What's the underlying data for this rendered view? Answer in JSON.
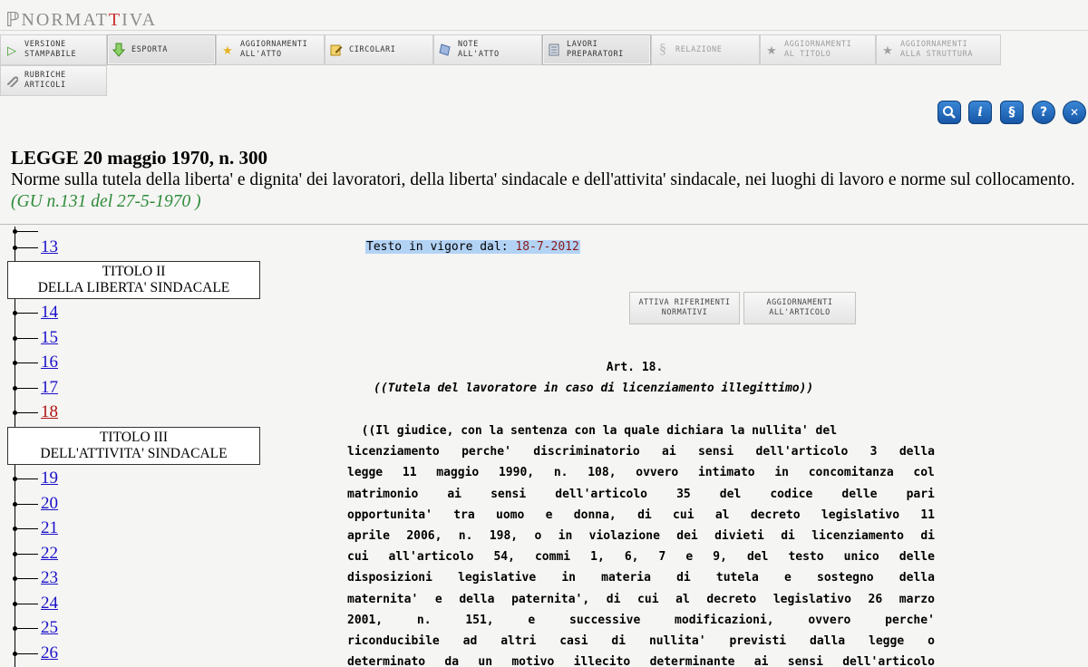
{
  "app": {
    "logo_mark": "ℙ",
    "logo_name_a": "NORMAT",
    "logo_name_b": "T",
    "logo_name_c": "IVA"
  },
  "toolbar": [
    {
      "id": "versione",
      "label": "VERSIONE\nSTAMPABILE",
      "icon": "play-icon",
      "color": "#3a9a2a"
    },
    {
      "id": "esporta",
      "label": "ESPORTA",
      "icon": "download-arrow-icon",
      "color": "#5aa532"
    },
    {
      "id": "agg-atto",
      "label": "AGGIORNAMENTI\nALL'ATTO",
      "icon": "star-icon",
      "color": "#e6b320"
    },
    {
      "id": "circolari",
      "label": "CIRCOLARI",
      "icon": "edit-note-icon",
      "color": "#d9a520"
    },
    {
      "id": "note",
      "label": "NOTE\nALL'ATTO",
      "icon": "note-icon",
      "color": "#6a8fc7"
    },
    {
      "id": "lavori",
      "label": "LAVORI\nPREPARATORI",
      "icon": "document-icon",
      "color": "#8a8a8a"
    },
    {
      "id": "relazione",
      "label": "RELAZIONE",
      "icon": "section-icon",
      "color": "#b5b5b5"
    },
    {
      "id": "agg-titolo",
      "label": "AGGIORNAMENTI\nAL TITOLO",
      "icon": "star-icon",
      "color": "#a0a0a0"
    },
    {
      "id": "agg-struttura",
      "label": "AGGIORNAMENTI\nALLA STRUTTURA",
      "icon": "star-icon",
      "color": "#a0a0a0"
    },
    {
      "id": "rubriche",
      "label": "RUBRICHE\nARTICOLI",
      "icon": "paperclip-icon",
      "color": "#888888"
    }
  ],
  "right_icons": [
    "search-icon",
    "info-icon",
    "link-icon",
    "help-icon",
    "close-icon"
  ],
  "right_icon_glyphs": {
    "search": "⚲",
    "info": "i",
    "link": "§",
    "help": "?",
    "close": "✕"
  },
  "law": {
    "title": "LEGGE 20 maggio 1970, n. 300",
    "description": "Norme sulla tutela della liberta' e dignita' dei lavoratori, della liberta' sindacale e dell'attivita' sindacale, nei luoghi di lavoro e norme sul collocamento.",
    "gu": "(GU n.131 del 27-5-1970 )"
  },
  "tree": {
    "items_a": [
      "13"
    ],
    "titolo2": {
      "line1": "TITOLO II",
      "line2": "DELLA LIBERTA' SINDACALE"
    },
    "items_b": [
      "14",
      "15",
      "16",
      "17",
      "18"
    ],
    "current": "18",
    "titolo3": {
      "line1": "TITOLO III",
      "line2": "DELL'ATTIVITA' SINDACALE"
    },
    "items_c": [
      "19",
      "20",
      "21",
      "22",
      "23",
      "24",
      "25",
      "26"
    ]
  },
  "content": {
    "vigore_label": "Testo in vigore dal:",
    "vigore_date": "18-7-2012",
    "btn_riferimenti": "ATTIVA RIFERIMENTI\nNORMATIVI",
    "btn_aggiornamenti": "AGGIORNAMENTI\nALL'ARTICOLO",
    "art_num": "Art. 18.",
    "art_title": "((Tutela del lavoratore in caso di licenziamento illegittimo))",
    "body_lines": [
      "  ((Il giudice, con la sentenza con la quale dichiara la nullita' del",
      "licenziamento perche' discriminatorio ai sensi dell'articolo 3  della",
      "legge 11 maggio 1990, n. 108, ovvero  intimato  in  concomitanza  col",
      "matrimonio ai sensi dell'articolo 35 del  codice  delle  pari",
      "opportunita' tra uomo e donna,  di cui al decreto legislativo  11",
      "aprile 2006, n. 198, o in violazione dei divieti di licenziamento  di",
      "cui all'articolo 54, commi 1,  6,  7  e  9,  del  testo  unico  delle",
      "disposizioni legislative  in  materia  di  tutela  e  sostegno  della",
      "maternita' e della paternita', di cui al decreto legislativo 26 marzo",
      "2001,  n.   151,   e   successive   modificazioni,   ovvero   perche'",
      "riconducibile ad altri  casi  di  nullita'  previsti  dalla  legge  o",
      "determinato da un motivo illecito determinante ai sensi dell'articolo"
    ]
  }
}
